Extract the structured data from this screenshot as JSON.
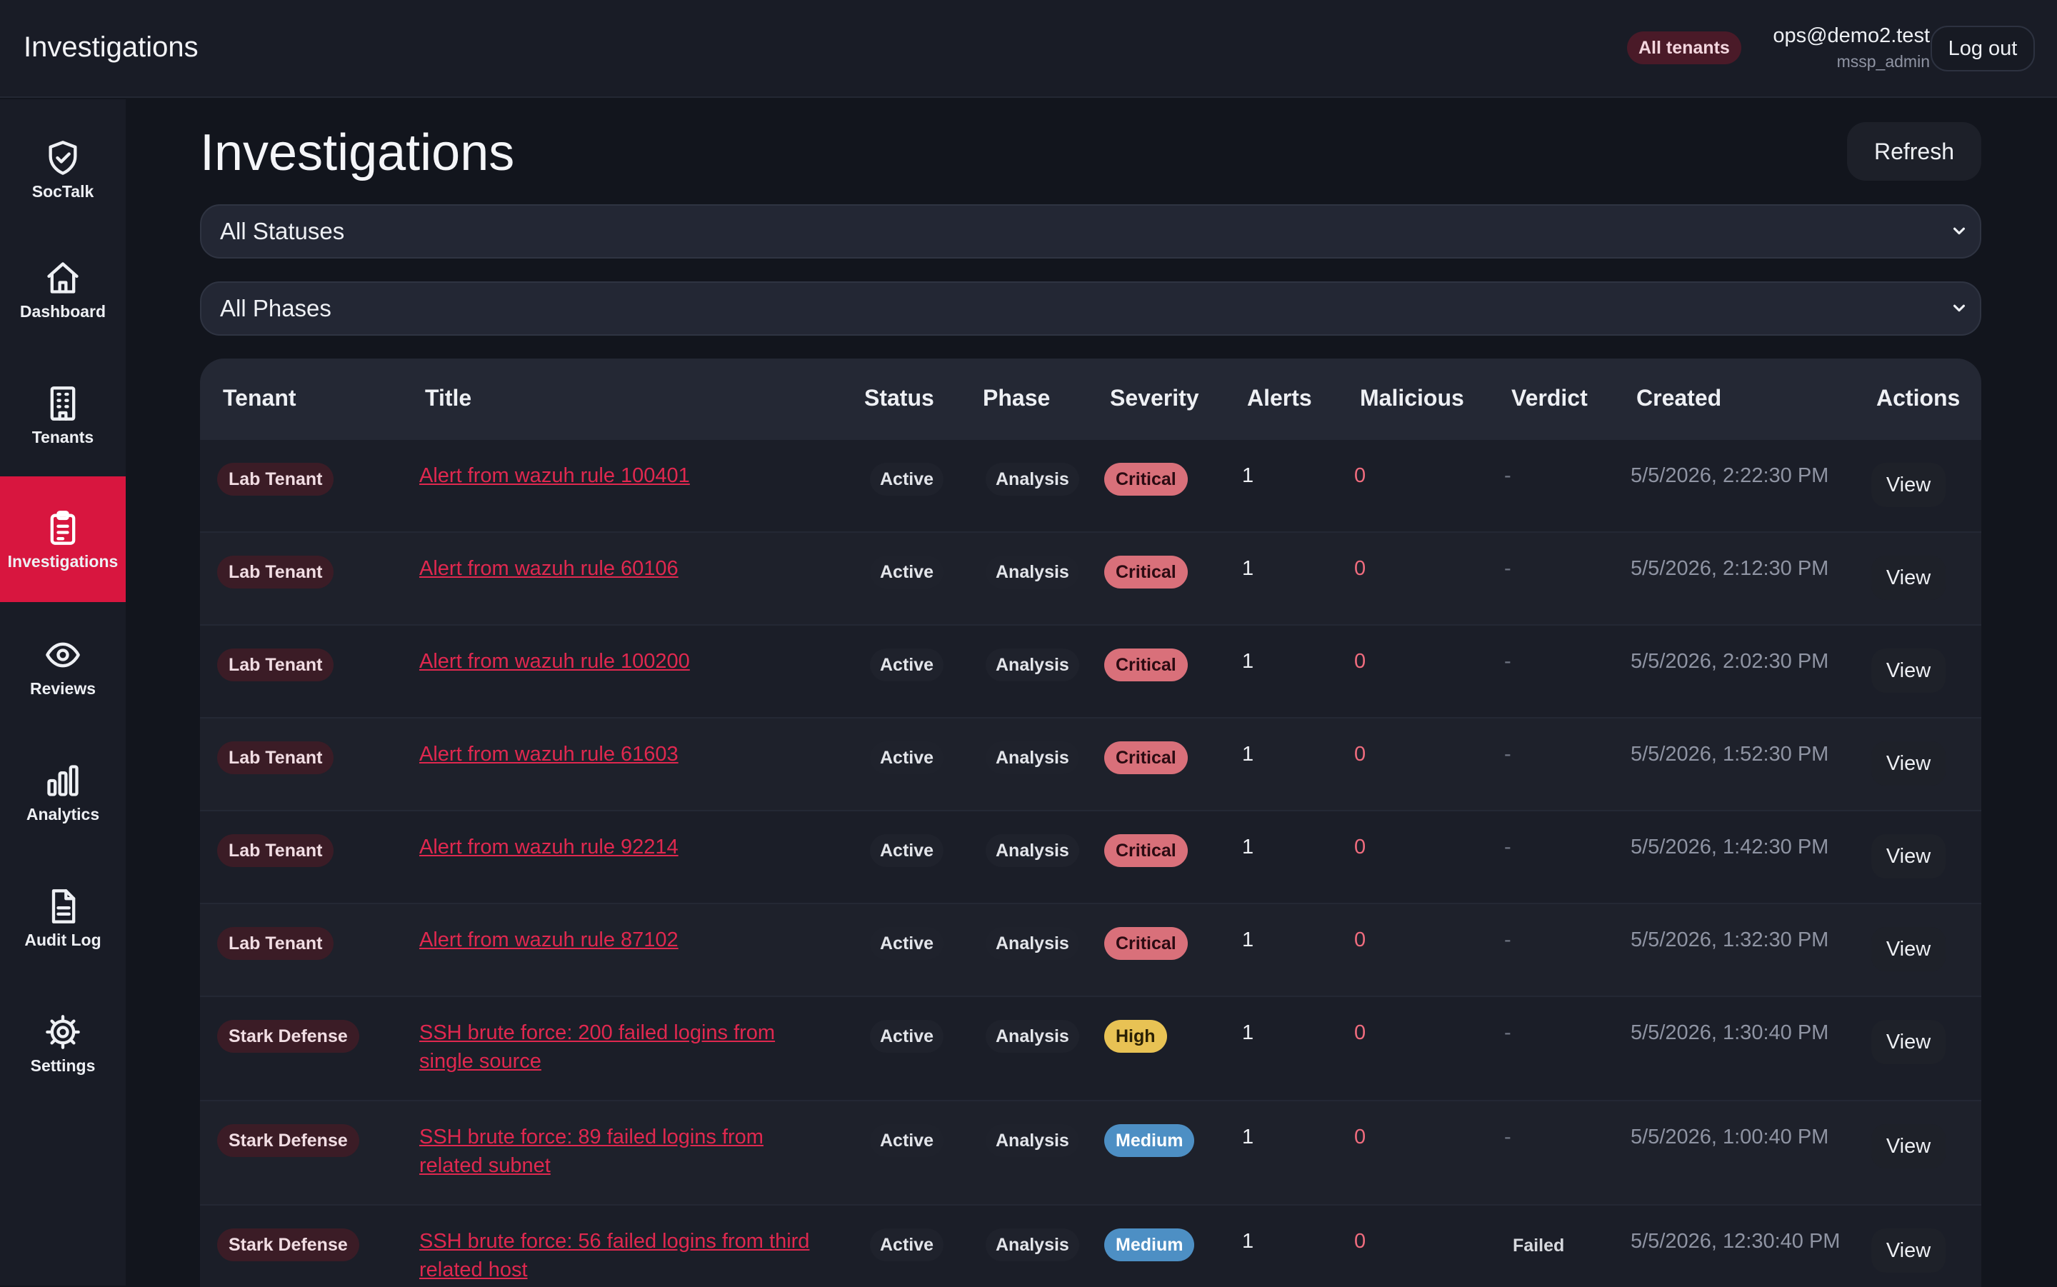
{
  "app": {
    "title": "Investigations",
    "tenant_scope": "All tenants",
    "user_email": "ops@demo2.test",
    "user_role": "mssp_admin",
    "logout_label": "Log out"
  },
  "sidebar": {
    "items": [
      {
        "label": "SocTalk",
        "icon": "shield-check-icon",
        "active": false
      },
      {
        "label": "Dashboard",
        "icon": "home-icon",
        "active": false
      },
      {
        "label": "Tenants",
        "icon": "building-icon",
        "active": false
      },
      {
        "label": "Investigations",
        "icon": "clipboard-icon",
        "active": true
      },
      {
        "label": "Reviews",
        "icon": "eye-icon",
        "active": false
      },
      {
        "label": "Analytics",
        "icon": "bar-chart-icon",
        "active": false
      },
      {
        "label": "Audit Log",
        "icon": "document-icon",
        "active": false
      },
      {
        "label": "Settings",
        "icon": "gear-icon",
        "active": false
      }
    ]
  },
  "page": {
    "title": "Investigations",
    "refresh_label": "Refresh"
  },
  "filters": {
    "status_selected": "All Statuses",
    "phase_selected": "All Phases"
  },
  "table": {
    "columns": [
      "Tenant",
      "Title",
      "Status",
      "Phase",
      "Severity",
      "Alerts",
      "Malicious",
      "Verdict",
      "Created",
      "Actions"
    ],
    "rows": [
      {
        "tenant": "Lab Tenant",
        "title": "Alert from wazuh rule 100401",
        "status": "Active",
        "phase": "Analysis",
        "severity": "Critical",
        "alerts": "1",
        "malicious": "0",
        "verdict": "-",
        "created": "5/5/2026, 2:22:30 PM",
        "action": "View"
      },
      {
        "tenant": "Lab Tenant",
        "title": "Alert from wazuh rule 60106",
        "status": "Active",
        "phase": "Analysis",
        "severity": "Critical",
        "alerts": "1",
        "malicious": "0",
        "verdict": "-",
        "created": "5/5/2026, 2:12:30 PM",
        "action": "View"
      },
      {
        "tenant": "Lab Tenant",
        "title": "Alert from wazuh rule 100200",
        "status": "Active",
        "phase": "Analysis",
        "severity": "Critical",
        "alerts": "1",
        "malicious": "0",
        "verdict": "-",
        "created": "5/5/2026, 2:02:30 PM",
        "action": "View"
      },
      {
        "tenant": "Lab Tenant",
        "title": "Alert from wazuh rule 61603",
        "status": "Active",
        "phase": "Analysis",
        "severity": "Critical",
        "alerts": "1",
        "malicious": "0",
        "verdict": "-",
        "created": "5/5/2026, 1:52:30 PM",
        "action": "View"
      },
      {
        "tenant": "Lab Tenant",
        "title": "Alert from wazuh rule 92214",
        "status": "Active",
        "phase": "Analysis",
        "severity": "Critical",
        "alerts": "1",
        "malicious": "0",
        "verdict": "-",
        "created": "5/5/2026, 1:42:30 PM",
        "action": "View"
      },
      {
        "tenant": "Lab Tenant",
        "title": "Alert from wazuh rule 87102",
        "status": "Active",
        "phase": "Analysis",
        "severity": "Critical",
        "alerts": "1",
        "malicious": "0",
        "verdict": "-",
        "created": "5/5/2026, 1:32:30 PM",
        "action": "View"
      },
      {
        "tenant": "Stark Defense",
        "title": "SSH brute force: 200 failed logins from single source",
        "status": "Active",
        "phase": "Analysis",
        "severity": "High",
        "alerts": "1",
        "malicious": "0",
        "verdict": "-",
        "created": "5/5/2026, 1:30:40 PM",
        "action": "View"
      },
      {
        "tenant": "Stark Defense",
        "title": "SSH brute force: 89 failed logins from related subnet",
        "status": "Active",
        "phase": "Analysis",
        "severity": "Medium",
        "alerts": "1",
        "malicious": "0",
        "verdict": "-",
        "created": "5/5/2026, 1:00:40 PM",
        "action": "View"
      },
      {
        "tenant": "Stark Defense",
        "title": "SSH brute force: 56 failed logins from third related host",
        "status": "Active",
        "phase": "Analysis",
        "severity": "Medium",
        "alerts": "1",
        "malicious": "0",
        "verdict": "Failed",
        "created": "5/5/2026, 12:30:40 PM",
        "action": "View"
      }
    ]
  },
  "colors": {
    "accent": "#d8163f",
    "critical": "#d9707a",
    "high": "#e8c254",
    "medium": "#4d8fc4"
  }
}
